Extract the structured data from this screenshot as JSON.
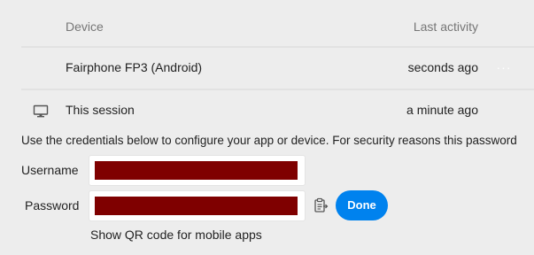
{
  "sessions_table": {
    "headers": {
      "device": "Device",
      "last_activity": "Last activity"
    },
    "rows": [
      {
        "device": "Fairphone FP3 (Android)",
        "last_activity": "seconds ago",
        "more_label": "···"
      },
      {
        "icon": "monitor-icon",
        "device": "This session",
        "last_activity": "a minute ago"
      }
    ]
  },
  "credentials": {
    "info_text": "Use the credentials below to configure your app or device. For security reasons this password",
    "username_label": "Username",
    "password_label": "Password",
    "username_value": "",
    "password_value": "",
    "copy_icon": "clipboard-icon",
    "done_label": "Done",
    "qr_link": "Show QR code for mobile apps"
  },
  "colors": {
    "background": "#ededed",
    "accent": "#0082ee",
    "redaction": "#7f0000"
  }
}
